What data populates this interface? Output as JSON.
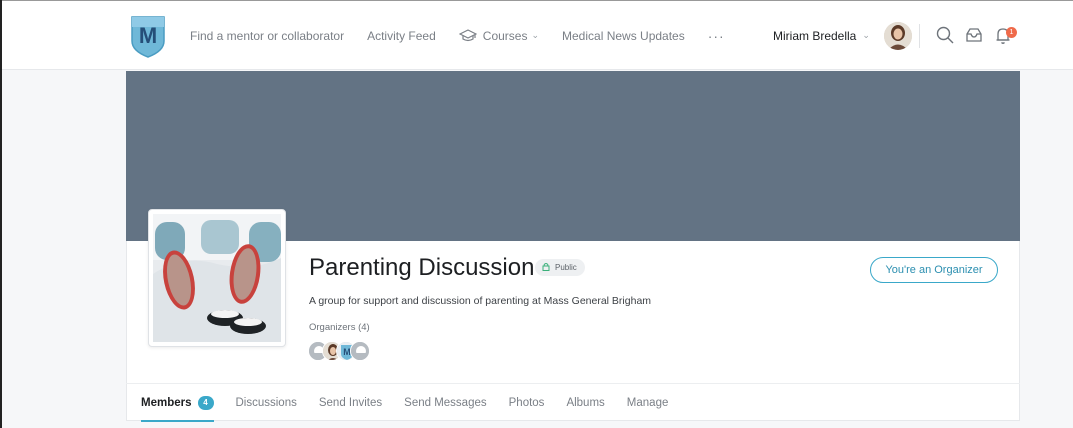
{
  "nav": {
    "items": [
      {
        "label": "Find a mentor or collaborator"
      },
      {
        "label": "Activity Feed"
      },
      {
        "label": "Courses"
      },
      {
        "label": "Medical News Updates"
      }
    ],
    "more": "···"
  },
  "user": {
    "name": "Miriam Bredella"
  },
  "notifications": {
    "count": "1"
  },
  "group": {
    "title": "Parenting Discussion",
    "visibility": "Public",
    "description": "A group for support and discussion of parenting at Mass General Brigham",
    "organizers_label": "Organizers (4)",
    "organizer_button": "You're an Organizer"
  },
  "tabs": [
    {
      "label": "Members",
      "count": "4"
    },
    {
      "label": "Discussions"
    },
    {
      "label": "Send Invites"
    },
    {
      "label": "Send Messages"
    },
    {
      "label": "Photos"
    },
    {
      "label": "Albums"
    },
    {
      "label": "Manage"
    }
  ],
  "colors": {
    "accent": "#3aa8c9",
    "cover": "#637384",
    "badge": "#ef6a4a",
    "public_lock": "#3bb07a"
  },
  "icons": [
    "logo-shield",
    "graduation-cap-icon",
    "chevron-down-icon",
    "search-icon",
    "inbox-icon",
    "bell-icon",
    "lock-icon"
  ]
}
